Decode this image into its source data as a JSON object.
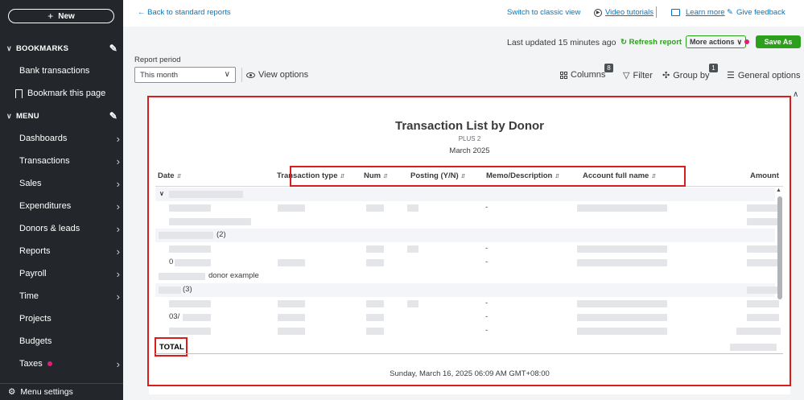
{
  "sidebar": {
    "new_label": "New",
    "bookmarks_label": "BOOKMARKS",
    "bookmark_items": [
      "Bank transactions",
      "Bookmark this page"
    ],
    "menu_label": "MENU",
    "menu_items": [
      "Dashboards",
      "Transactions",
      "Sales",
      "Expenditures",
      "Donors & leads",
      "Reports",
      "Payroll",
      "Time",
      "Projects",
      "Budgets",
      "Taxes"
    ],
    "footer_label": "Menu settings",
    "accent_dot_color": "#e31c79"
  },
  "topbar": {
    "back_label": "Back to standard reports",
    "classic_label": "Switch to classic view",
    "video_label": "Video tutorials",
    "learn_label": "Learn more",
    "feedback_label": "Give feedback"
  },
  "actions": {
    "last_updated": "Last updated 15 minutes ago",
    "refresh_label": "Refresh report",
    "more_actions_label": "More actions",
    "save_as_label": "Save As"
  },
  "filters": {
    "report_period_label": "Report period",
    "report_period_value": "This month",
    "view_options_label": "View options",
    "columns_label": "Columns",
    "columns_count": "8",
    "filter_label": "Filter",
    "group_by_label": "Group by",
    "group_by_count": "1",
    "general_options_label": "General options"
  },
  "report": {
    "title": "Transaction List by Donor",
    "company": "PLUS 2",
    "period": "March 2025",
    "columns": [
      "Date",
      "Transaction type",
      "Num",
      "Posting (Y/N)",
      "Memo/Description",
      "Account full name",
      "Amount"
    ],
    "group_frag_1": "(2)",
    "group_frag_2": "donor example",
    "group_frag_3": "(3)",
    "date_frag_1": "0",
    "date_frag_2": "03/",
    "dash": "-",
    "total_label": "TOTAL",
    "footer_timestamp": "Sunday, March 16, 2025 06:09 AM GMT+08:00"
  }
}
